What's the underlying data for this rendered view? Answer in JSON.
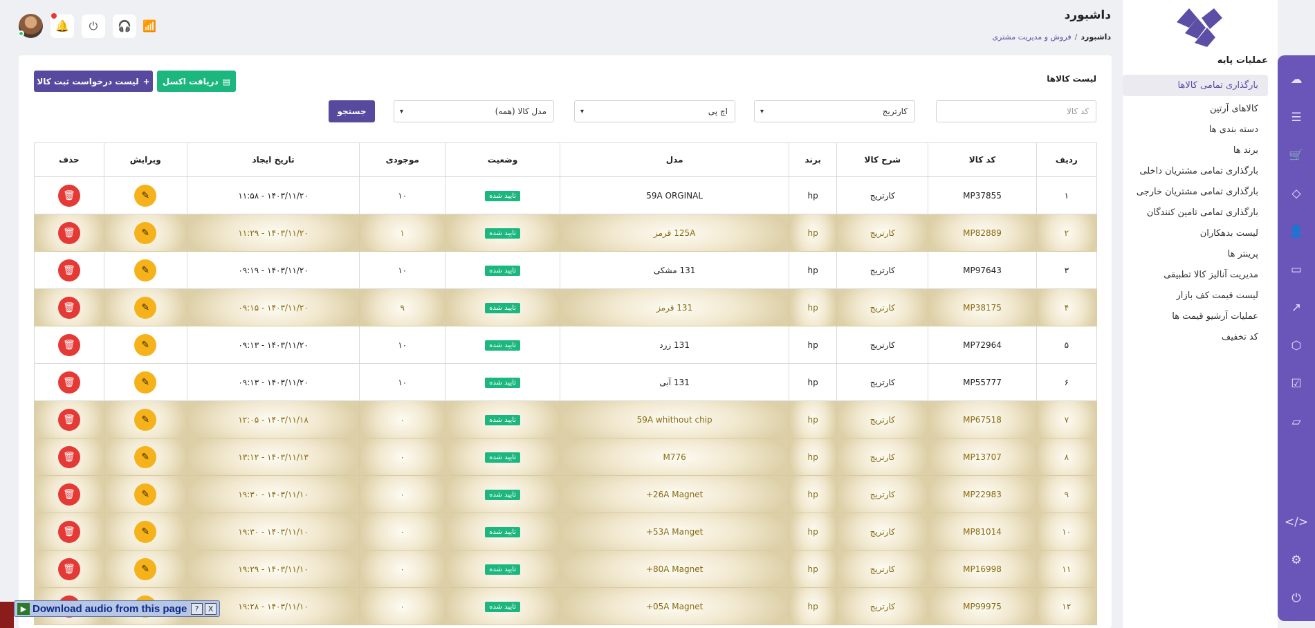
{
  "page": {
    "title": "داشبورد",
    "breadcrumb": [
      "داشبورد",
      "فروش و مدیریت مشتری"
    ]
  },
  "sidebar": {
    "section_title": "عملیات پایه",
    "items": [
      {
        "label": "بارگذاری تمامی کالاها",
        "active": true
      },
      {
        "label": "کالاهای آرتین"
      },
      {
        "label": "دسته بندی ها"
      },
      {
        "label": "برند ها"
      },
      {
        "label": "بارگذاری تمامی مشتریان داخلی"
      },
      {
        "label": "بارگذاری تمامی مشتریان خارجی"
      },
      {
        "label": "بارگذاری تمامی تامین کنندگان"
      },
      {
        "label": "لیست بدهکاران"
      },
      {
        "label": "پرینتر ها"
      },
      {
        "label": "مدیریت آنالیز کالا تطبیقی"
      },
      {
        "label": "لیست قیمت کف بازار"
      },
      {
        "label": "عملیات آرشیو قیمت ها"
      },
      {
        "label": "کد تخفیف"
      }
    ]
  },
  "rail_icons": [
    "dashboard-icon",
    "list-icon",
    "cart-icon",
    "cube-icon",
    "user-icon",
    "message-icon",
    "external-link-icon",
    "box-icon",
    "check-square-icon",
    "folder-icon",
    "code-icon",
    "settings-icon",
    "power-icon"
  ],
  "card": {
    "title": "لیست کالاها",
    "excel_button": "دریافت اکسل",
    "request_button": "لیست درخواست ثبت کالا",
    "filters": {
      "code_placeholder": "کد کالا",
      "type_value": "کارتریج",
      "brand_value": "اچ پی",
      "model_value": "مدل کالا (همه)"
    },
    "search_button": "جستجو"
  },
  "table": {
    "headers": [
      "ردیف",
      "کد کالا",
      "شرح کالا",
      "برند",
      "مدل",
      "وضعیت",
      "موجودی",
      "تاریخ ایجاد",
      "ویرایش",
      "حذف"
    ],
    "rows": [
      {
        "row": "۱",
        "code": "MP37855",
        "desc": "کارتریج",
        "brand": "hp",
        "model": "59A ORGINAL",
        "status": "تایید شده",
        "stock": "۱۰",
        "date": "۱۴۰۳/۱۱/۲۰ - ۱۱:۵۸",
        "gold": false
      },
      {
        "row": "۲",
        "code": "MP82889",
        "desc": "کارتریج",
        "brand": "hp",
        "model": "125A قرمز",
        "status": "تایید شده",
        "stock": "۱",
        "date": "۱۴۰۳/۱۱/۲۰ - ۱۱:۲۹",
        "gold": true
      },
      {
        "row": "۳",
        "code": "MP97643",
        "desc": "کارتریج",
        "brand": "hp",
        "model": "131 مشکی",
        "status": "تایید شده",
        "stock": "۱۰",
        "date": "۱۴۰۳/۱۱/۲۰ - ۰۹:۱۹",
        "gold": false
      },
      {
        "row": "۴",
        "code": "MP38175",
        "desc": "کارتریج",
        "brand": "hp",
        "model": "131 قرمز",
        "status": "تایید شده",
        "stock": "۹",
        "date": "۱۴۰۳/۱۱/۲۰ - ۰۹:۱۵",
        "gold": true
      },
      {
        "row": "۵",
        "code": "MP72964",
        "desc": "کارتریج",
        "brand": "hp",
        "model": "131 زرد",
        "status": "تایید شده",
        "stock": "۱۰",
        "date": "۱۴۰۳/۱۱/۲۰ - ۰۹:۱۳",
        "gold": false
      },
      {
        "row": "۶",
        "code": "MP55777",
        "desc": "کارتریج",
        "brand": "hp",
        "model": "131 آبی",
        "status": "تایید شده",
        "stock": "۱۰",
        "date": "۱۴۰۳/۱۱/۲۰ - ۰۹:۱۳",
        "gold": false
      },
      {
        "row": "۷",
        "code": "MP67518",
        "desc": "کارتریج",
        "brand": "hp",
        "model": "59A whithout chip",
        "status": "تایید شده",
        "stock": "۰",
        "date": "۱۴۰۳/۱۱/۱۸ - ۱۲:۰۵",
        "gold": true
      },
      {
        "row": "۸",
        "code": "MP13707",
        "desc": "کارتریج",
        "brand": "hp",
        "model": "M776",
        "status": "تایید شده",
        "stock": "۰",
        "date": "۱۴۰۳/۱۱/۱۳ - ۱۳:۱۲",
        "gold": true
      },
      {
        "row": "۹",
        "code": "MP22983",
        "desc": "کارتریج",
        "brand": "hp",
        "model": "26A Magnet+",
        "status": "تایید شده",
        "stock": "۰",
        "date": "۱۴۰۳/۱۱/۱۰ - ۱۹:۳۰",
        "gold": true
      },
      {
        "row": "۱۰",
        "code": "MP81014",
        "desc": "کارتریج",
        "brand": "hp",
        "model": "53A Manget+",
        "status": "تایید شده",
        "stock": "۰",
        "date": "۱۴۰۳/۱۱/۱۰ - ۱۹:۳۰",
        "gold": true
      },
      {
        "row": "۱۱",
        "code": "MP16998",
        "desc": "کارتریج",
        "brand": "hp",
        "model": "80A Magnet+",
        "status": "تایید شده",
        "stock": "۰",
        "date": "۱۴۰۳/۱۱/۱۰ - ۱۹:۲۹",
        "gold": true
      },
      {
        "row": "۱۲",
        "code": "MP99975",
        "desc": "کارتریج",
        "brand": "hp",
        "model": "05A Magnet+",
        "status": "تایید شده",
        "stock": "۰",
        "date": "۱۴۰۳/۱۱/۱۰ - ۱۹:۲۸",
        "gold": true
      }
    ]
  },
  "widget": {
    "download_label": "Download audio from this page",
    "help": "?",
    "close": "X"
  },
  "colors": {
    "primary": "#574a9e",
    "rail": "#6a55b8",
    "success": "#1bb77e",
    "edit": "#f6b21b",
    "delete": "#e53935"
  }
}
